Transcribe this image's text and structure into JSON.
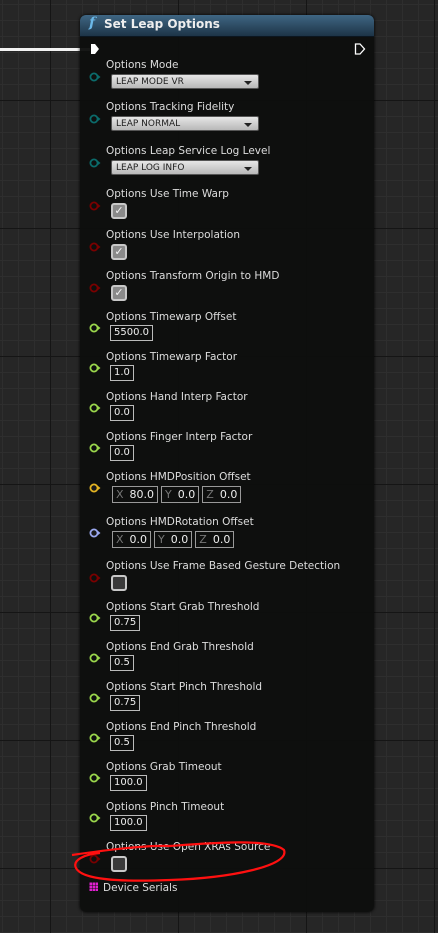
{
  "node": {
    "title": "Set Leap Options",
    "icon": "function-icon"
  },
  "pin_colors": {
    "enum": "#0b6b6b",
    "bool": "#7a0000",
    "float": "#9ad64c",
    "vector": "#e3b422",
    "rotator": "#9aa8ef",
    "struct": "#e020d0"
  },
  "inputs": [
    {
      "label": "Options Mode",
      "type": "enum",
      "value": "LEAP MODE VR"
    },
    {
      "label": "Options Tracking Fidelity",
      "type": "enum",
      "value": "LEAP NORMAL"
    },
    {
      "label": "Options Leap Service Log Level",
      "type": "enum",
      "value": "LEAP LOG INFO"
    },
    {
      "label": "Options Use Time Warp",
      "type": "bool",
      "checked": true
    },
    {
      "label": "Options Use Interpolation",
      "type": "bool",
      "checked": true
    },
    {
      "label": "Options Transform Origin to HMD",
      "type": "bool",
      "checked": true
    },
    {
      "label": "Options Timewarp Offset",
      "type": "float",
      "value": "5500.0"
    },
    {
      "label": "Options Timewarp Factor",
      "type": "float",
      "value": "1.0"
    },
    {
      "label": "Options Hand Interp Factor",
      "type": "float",
      "value": "0.0"
    },
    {
      "label": "Options Finger Interp Factor",
      "type": "float",
      "value": "0.0"
    },
    {
      "label": "Options HMDPosition Offset",
      "type": "vector",
      "axes": [
        "X",
        "Y",
        "Z"
      ],
      "values": [
        "80.0",
        "0.0",
        "0.0"
      ]
    },
    {
      "label": "Options HMDRotation Offset",
      "type": "rotator",
      "axes": [
        "X",
        "Y",
        "Z"
      ],
      "values": [
        "0.0",
        "0.0",
        "0.0"
      ]
    },
    {
      "label": "Options Use Frame Based Gesture Detection",
      "type": "bool",
      "checked": false
    },
    {
      "label": "Options Start Grab Threshold",
      "type": "float",
      "value": "0.75"
    },
    {
      "label": "Options End Grab Threshold",
      "type": "float",
      "value": "0.5"
    },
    {
      "label": "Options Start Pinch Threshold",
      "type": "float",
      "value": "0.75"
    },
    {
      "label": "Options End Pinch Threshold",
      "type": "float",
      "value": "0.5"
    },
    {
      "label": "Options Grab Timeout",
      "type": "float",
      "value": "100.0"
    },
    {
      "label": "Options Pinch Timeout",
      "type": "float",
      "value": "100.0"
    },
    {
      "label": "Options Use Open XRAs Source",
      "type": "bool",
      "checked": false
    },
    {
      "label": "Device Serials",
      "type": "struct"
    }
  ]
}
